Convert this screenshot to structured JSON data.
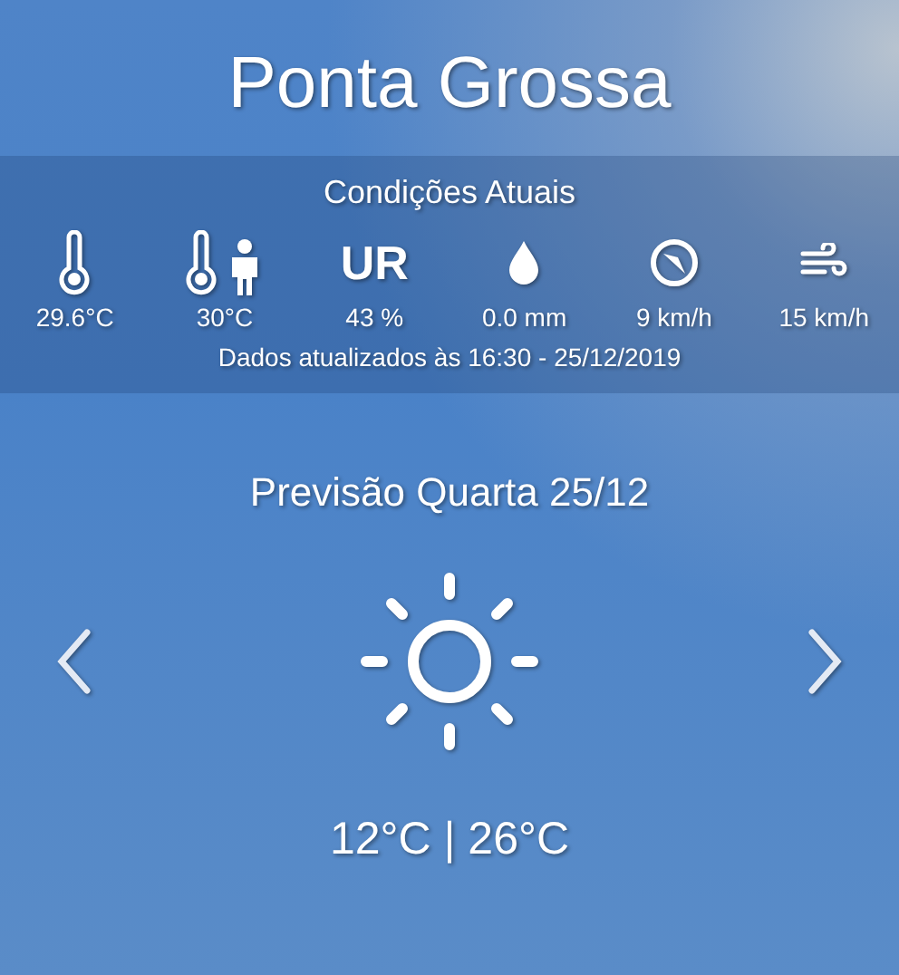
{
  "city": "Ponta Grossa",
  "current": {
    "title": "Condições Atuais",
    "metrics": [
      {
        "kind": "thermometer",
        "value": "29.6°C"
      },
      {
        "kind": "feels_like",
        "value": "30°C"
      },
      {
        "kind": "text",
        "symbol": "UR",
        "value": "43 %"
      },
      {
        "kind": "drop",
        "value": "0.0 mm"
      },
      {
        "kind": "compass",
        "value": "9 km/h"
      },
      {
        "kind": "wind",
        "value": "15 km/h"
      }
    ],
    "updated": "Dados atualizados às 16:30 - 25/12/2019"
  },
  "forecast": {
    "title": "Previsão Quarta 25/12",
    "kind": "sunny",
    "temps": "12°C | 26°C"
  }
}
